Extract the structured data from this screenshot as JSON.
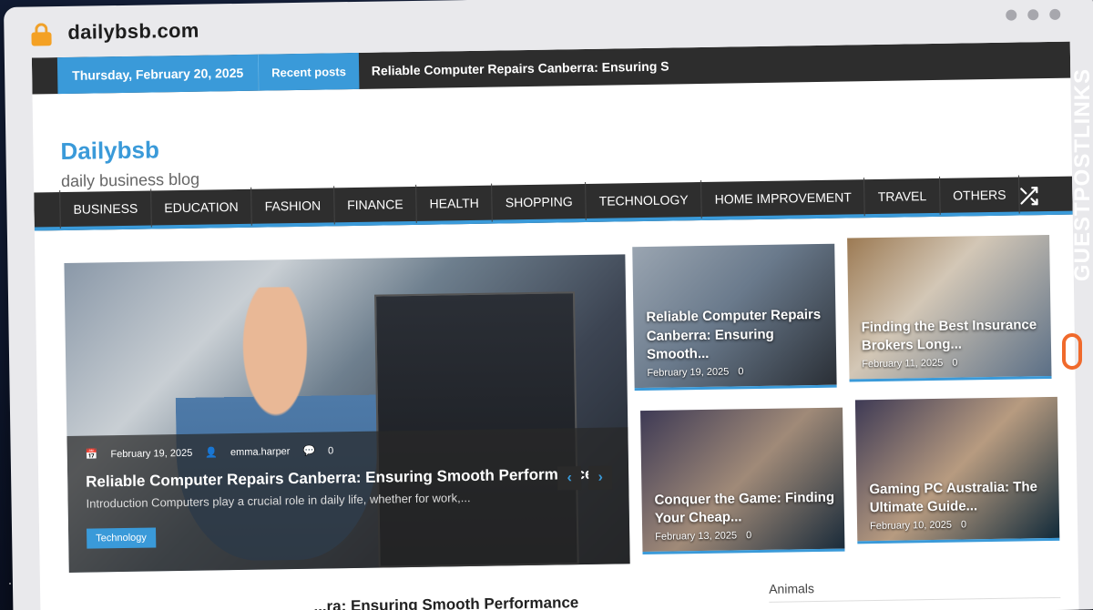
{
  "browser": {
    "url": "dailybsb.com"
  },
  "topbar": {
    "date": "Thursday, February 20, 2025",
    "recent_label": "Recent posts",
    "ticker": "Reliable Computer Repairs Canberra: Ensuring Smootl"
  },
  "site": {
    "title": "Dailybsb",
    "tagline": "daily business blog"
  },
  "nav": {
    "items": [
      "BUSINESS",
      "EDUCATION",
      "FASHION",
      "FINANCE",
      "HEALTH",
      "SHOPPING",
      "TECHNOLOGY",
      "HOME IMPROVEMENT",
      "TRAVEL",
      "OTHERS"
    ]
  },
  "hero": {
    "date": "February 19, 2025",
    "author": "emma.harper",
    "comments": "0",
    "title": "Reliable Computer Repairs Canberra: Ensuring Smooth Performance",
    "excerpt": "Introduction Computers play a crucial role in daily life, whether for work,...",
    "category": "Technology"
  },
  "cards": [
    {
      "title": "Reliable Computer Repairs Canberra: Ensuring Smooth...",
      "date": "February 19, 2025",
      "comments": "0"
    },
    {
      "title": "Finding the Best Insurance Brokers Long...",
      "date": "February 11, 2025",
      "comments": "0"
    },
    {
      "title": "Conquer the Game: Finding Your Cheap...",
      "date": "February 13, 2025",
      "comments": "0"
    },
    {
      "title": "Gaming PC Australia: The Ultimate Guide...",
      "date": "February 10, 2025",
      "comments": "0"
    }
  ],
  "sidebar": {
    "label": "Animals"
  },
  "below": {
    "title": "...ra: Ensuring Smooth Performance"
  },
  "watermark": {
    "text": "GUESTPOSTLINKS"
  },
  "colors": {
    "accent": "#3a9ad9",
    "dark": "#2d2d2d",
    "brand": "#f06a2c"
  },
  "icons": {
    "shuffle": "shuffle-icon",
    "lock": "lock-icon",
    "prev": "chevron-left-icon",
    "next": "chevron-right-icon"
  }
}
